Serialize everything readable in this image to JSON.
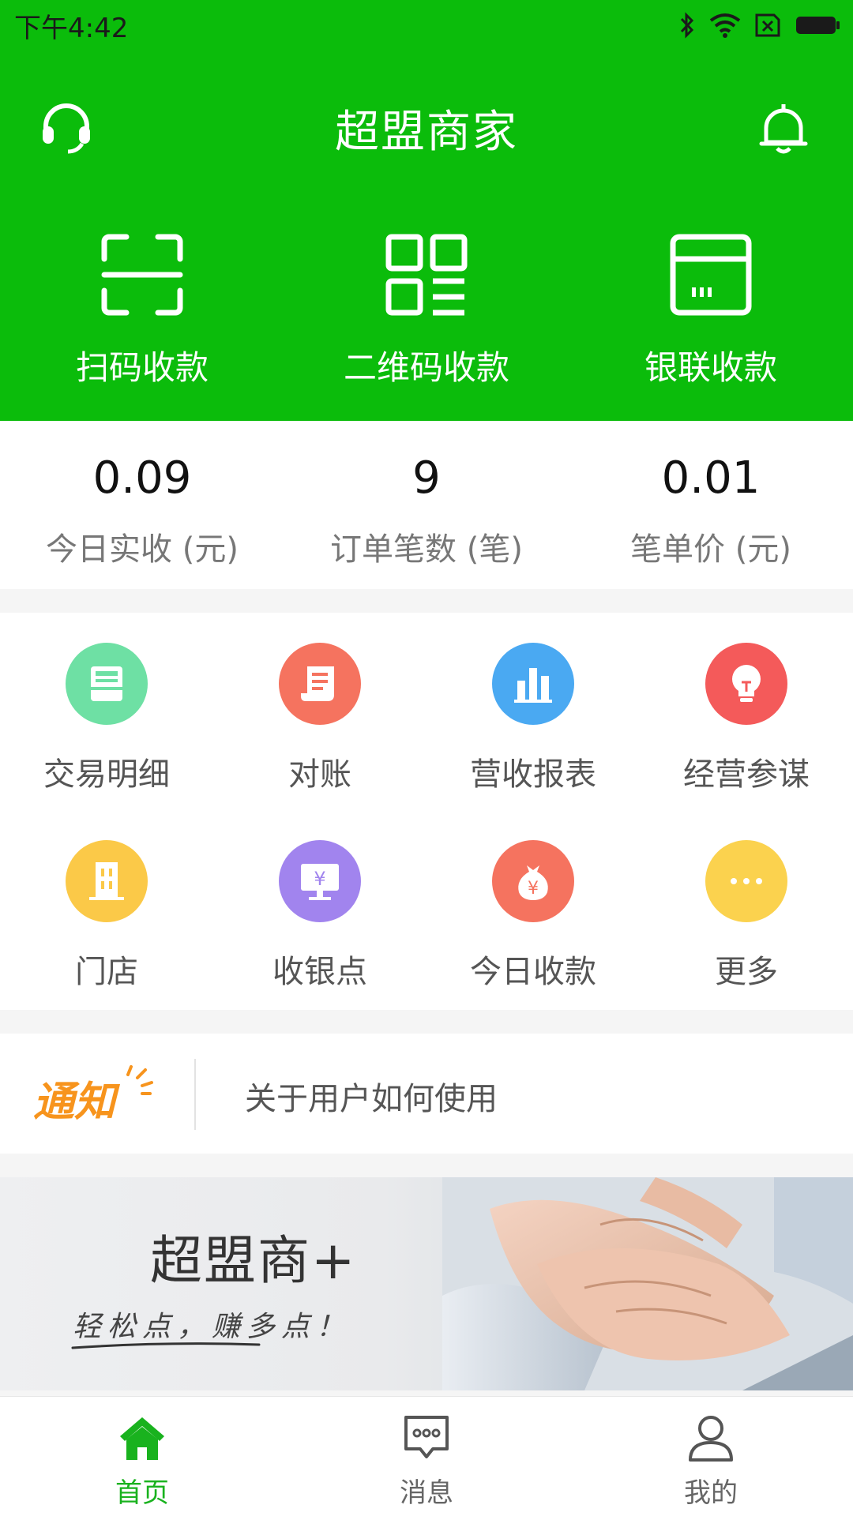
{
  "status_bar": {
    "time": "下午4:42"
  },
  "header": {
    "title": "超盟商家",
    "left_icon": "headset-icon",
    "right_icon": "bell-icon",
    "background": "#0bbc0b"
  },
  "payments": [
    {
      "label": "扫码收款",
      "icon": "scan-icon"
    },
    {
      "label": "二维码收款",
      "icon": "qrcode-icon"
    },
    {
      "label": "银联收款",
      "icon": "card-icon"
    }
  ],
  "stats": [
    {
      "value": "0.09",
      "label": "今日实收 (元)"
    },
    {
      "value": "9",
      "label": "订单笔数 (笔)"
    },
    {
      "value": "0.01",
      "label": "笔单价 (元)"
    }
  ],
  "grid": [
    {
      "label": "交易明细",
      "icon": "ledger-icon",
      "color": "#6ee0a4"
    },
    {
      "label": "对账",
      "icon": "scroll-icon",
      "color": "#f5735f"
    },
    {
      "label": "营收报表",
      "icon": "bar-chart-icon",
      "color": "#4aa9f2"
    },
    {
      "label": "经营参谋",
      "icon": "lightbulb-icon",
      "color": "#f45a5a"
    },
    {
      "label": "门店",
      "icon": "store-icon",
      "color": "#fbc948"
    },
    {
      "label": "收银点",
      "icon": "cashier-monitor-icon",
      "color": "#a184ee"
    },
    {
      "label": "今日收款",
      "icon": "money-bag-icon",
      "color": "#f5735f"
    },
    {
      "label": "更多",
      "icon": "more-icon",
      "color": "#fbd24e"
    }
  ],
  "notice": {
    "badge": "通知",
    "text": "关于用户如何使用"
  },
  "banner": {
    "title": "超盟商+",
    "slogan": "轻松点，赚多点！"
  },
  "tabs": [
    {
      "label": "首页",
      "icon": "home-icon",
      "active": true
    },
    {
      "label": "消息",
      "icon": "message-icon",
      "active": false
    },
    {
      "label": "我的",
      "icon": "profile-icon",
      "active": false
    }
  ],
  "colors": {
    "accent": "#0bbc0b",
    "tab_active": "#19b21e"
  }
}
